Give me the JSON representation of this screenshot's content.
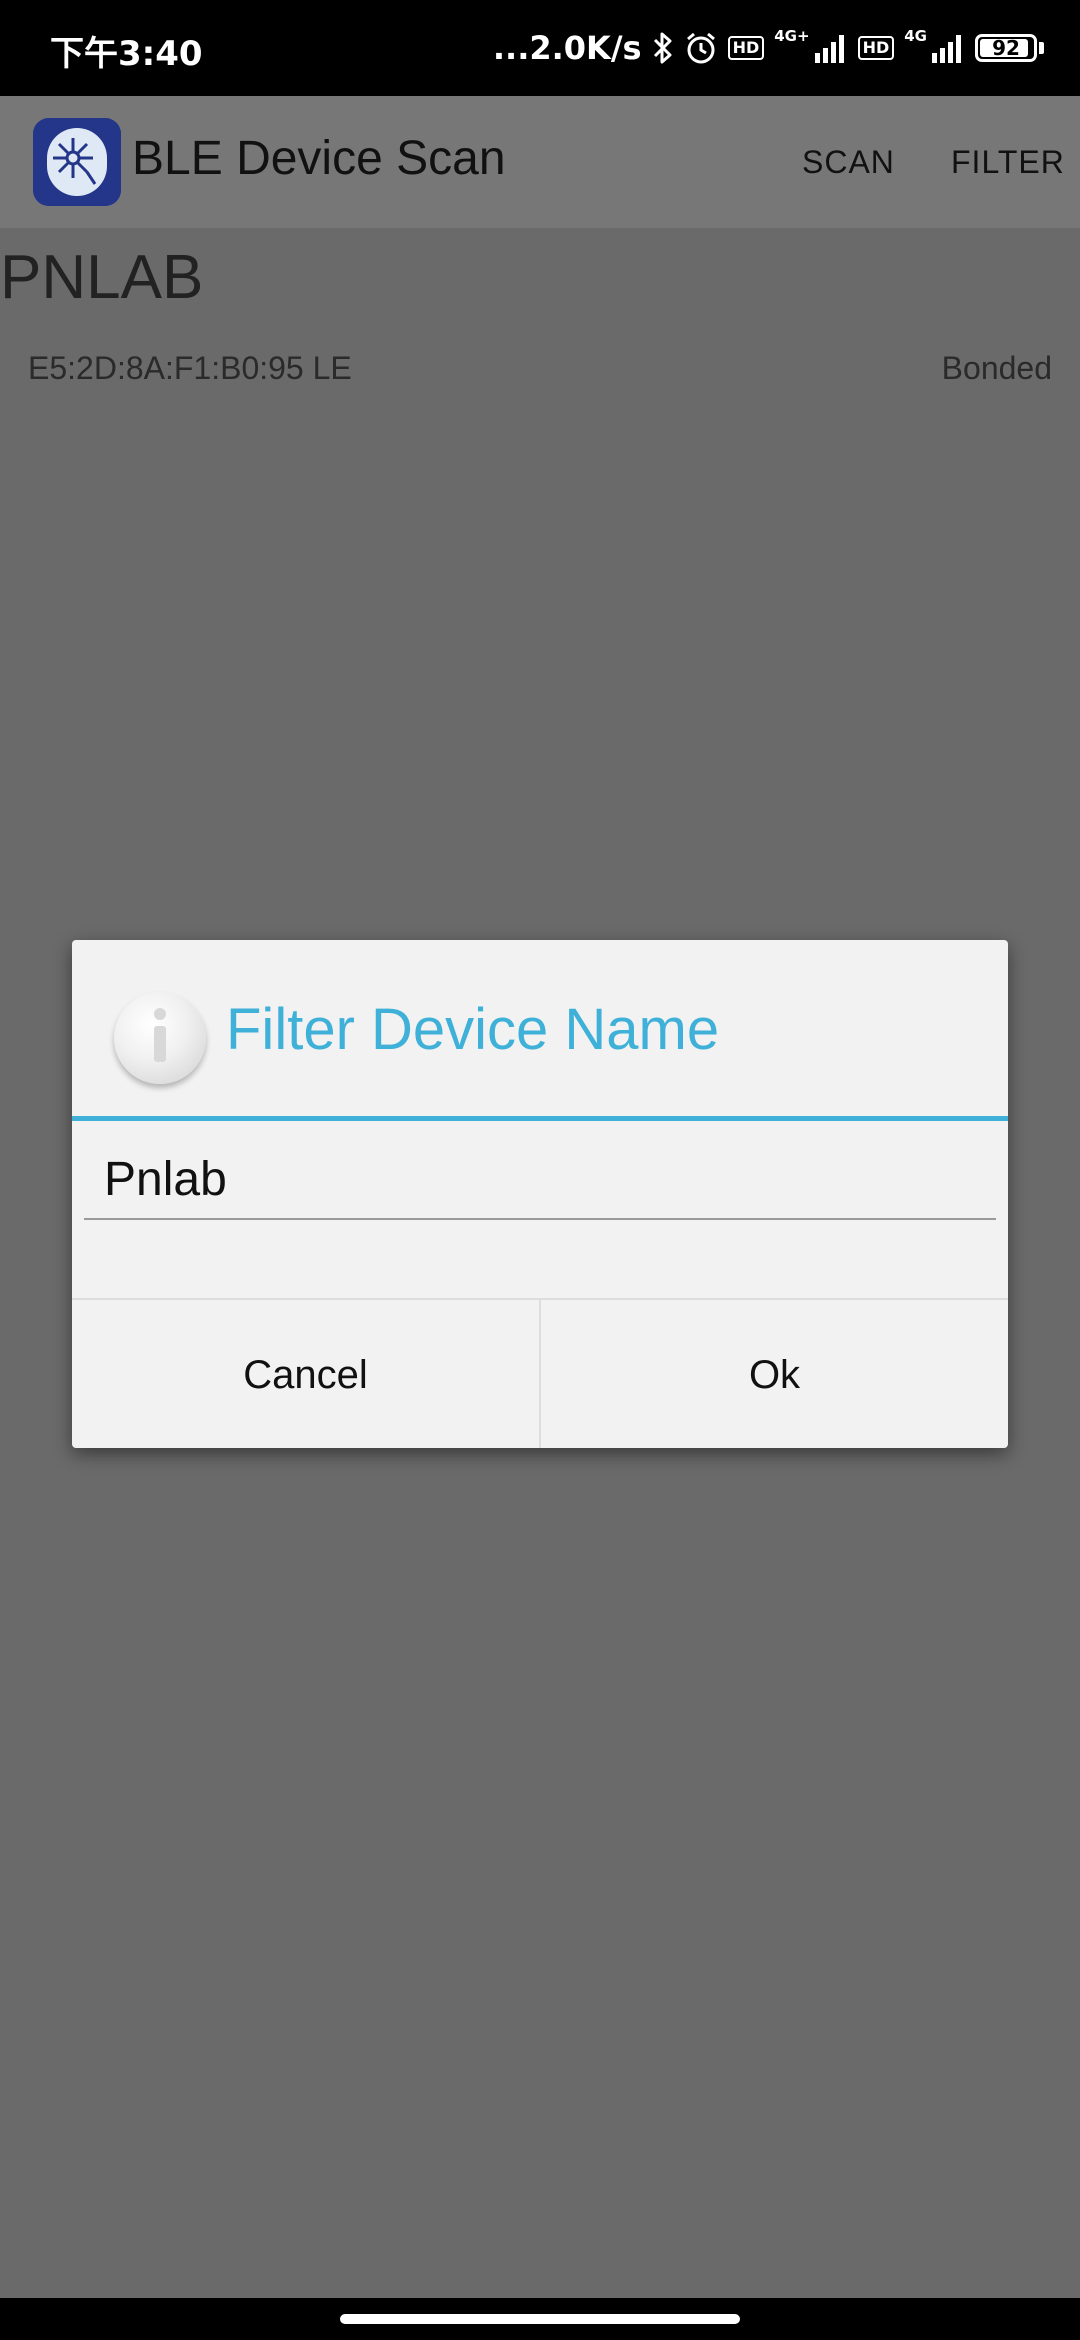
{
  "status_bar": {
    "time": "下午3:40",
    "speed": "...2.0K/s",
    "hd1": "HD",
    "net1": "4G+",
    "hd2": "HD",
    "net2": "4G",
    "battery_level": "92",
    "battery_fraction": 0.92,
    "icons": [
      "bluetooth-icon",
      "alarm-icon",
      "signal-icon",
      "signal-icon",
      "battery-icon"
    ]
  },
  "app_bar": {
    "title": "BLE Device Scan",
    "actions": {
      "scan": "SCAN",
      "filter": "FILTER"
    },
    "icon": "ble-app-icon",
    "color": "#777777"
  },
  "device_list": {
    "items": [
      {
        "name": "PNLAB",
        "address": "E5:2D:8A:F1:B0:95  LE",
        "status": "Bonded"
      }
    ]
  },
  "dialog": {
    "title": "Filter Device Name",
    "title_color": "#3fb0d8",
    "icon": "info-icon",
    "input_value": "Pnlab",
    "cancel_label": "Cancel",
    "ok_label": "Ok"
  }
}
